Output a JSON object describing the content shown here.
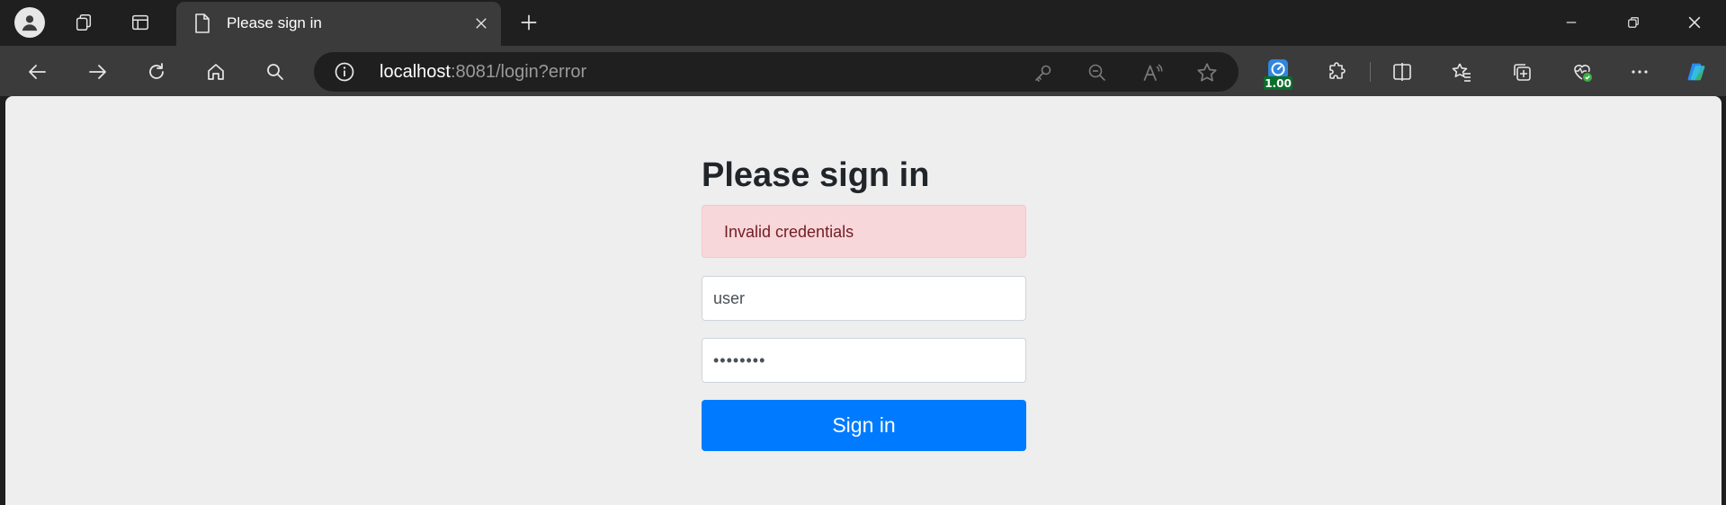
{
  "browser": {
    "tab": {
      "title": "Please sign in"
    },
    "address_bar": {
      "host": "localhost",
      "rest": ":8081/login?error"
    },
    "extension_badge": "1.00"
  },
  "colors": {
    "accent": "#007bff",
    "alert_bg": "#f8d7da",
    "alert_text": "#721c24",
    "page_bg": "#eeeeee"
  },
  "page": {
    "heading": "Please sign in",
    "alert": "Invalid credentials",
    "username": {
      "value": "user"
    },
    "password": {
      "masked_value": "••••••••"
    },
    "submit_label": "Sign in"
  },
  "icons": [
    "profile-icon",
    "workspaces-icon",
    "tab-actions-icon",
    "page-icon",
    "close-icon",
    "new-tab-icon",
    "minimize-icon",
    "restore-icon",
    "window-close-icon",
    "back-icon",
    "forward-icon",
    "reload-icon",
    "home-icon",
    "search-icon",
    "info-icon",
    "key-icon",
    "zoom-out-icon",
    "read-aloud-icon",
    "star-icon",
    "speed-extension-icon",
    "extensions-icon",
    "split-screen-icon",
    "favorites-icon",
    "collections-icon",
    "browser-essentials-icon",
    "more-icon",
    "copilot-icon"
  ]
}
